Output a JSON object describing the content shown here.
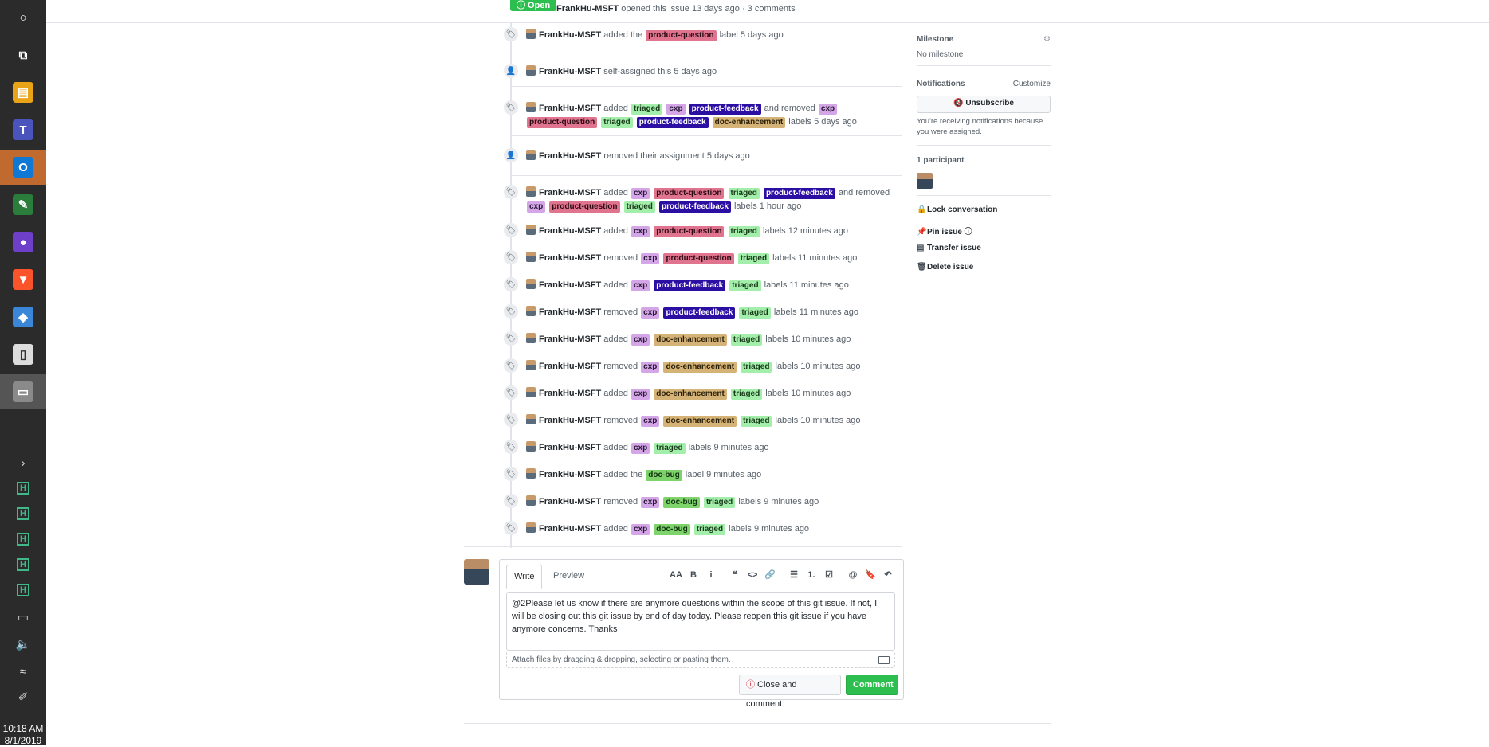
{
  "taskbar": {
    "apps": [
      {
        "name": "cortana",
        "glyph": "○"
      },
      {
        "name": "task-view",
        "glyph": "⧉"
      },
      {
        "name": "file-explorer",
        "glyph": "▤"
      },
      {
        "name": "teams",
        "glyph": "T"
      },
      {
        "name": "outlook",
        "glyph": "O"
      },
      {
        "name": "notepad-plus",
        "glyph": "✎"
      },
      {
        "name": "github-desktop",
        "glyph": "●"
      },
      {
        "name": "brave",
        "glyph": "▼"
      },
      {
        "name": "app-blue",
        "glyph": "◆"
      },
      {
        "name": "document",
        "glyph": "▯"
      },
      {
        "name": "app-window",
        "glyph": "▭"
      }
    ],
    "tray_glyphs": [
      "›",
      "H",
      "H",
      "H",
      "H",
      "H",
      "▭",
      "🔈",
      "≈",
      "✐"
    ],
    "time": "10:18 AM",
    "date": "8/1/2019"
  },
  "header": {
    "state": "ⓘ Open",
    "author": "FrankHu-MSFT",
    "meta": " opened this issue 13 days ago · 3 comments"
  },
  "timeline": [
    {
      "icon": "tag",
      "parts": [
        {
          "t": "text",
          "v": "added the"
        },
        {
          "t": "label",
          "v": "product-question"
        },
        {
          "t": "text",
          "v": "label 5 days ago"
        }
      ]
    },
    {
      "icon": "person",
      "parts": [
        {
          "t": "text",
          "v": "self-assigned this 5 days ago"
        }
      ]
    },
    {
      "icon": "tag",
      "parts": [
        {
          "t": "text",
          "v": "added"
        },
        {
          "t": "label",
          "v": "triaged"
        },
        {
          "t": "label",
          "v": "cxp"
        },
        {
          "t": "label",
          "v": "product-feedback"
        },
        {
          "t": "text",
          "v": "and removed"
        },
        {
          "t": "label",
          "v": "cxp"
        },
        {
          "t": "label",
          "v": "product-question"
        },
        {
          "t": "label",
          "v": "triaged"
        },
        {
          "t": "label",
          "v": "product-feedback"
        },
        {
          "t": "label",
          "v": "doc-enhancement"
        },
        {
          "t": "text",
          "v": "labels 5 days ago"
        }
      ]
    },
    {
      "icon": "person",
      "parts": [
        {
          "t": "text",
          "v": "removed their assignment 5 days ago"
        }
      ]
    },
    {
      "icon": "tag",
      "parts": [
        {
          "t": "text",
          "v": "added"
        },
        {
          "t": "label",
          "v": "cxp"
        },
        {
          "t": "label",
          "v": "product-question"
        },
        {
          "t": "label",
          "v": "triaged"
        },
        {
          "t": "label",
          "v": "product-feedback"
        },
        {
          "t": "text",
          "v": "and removed"
        },
        {
          "t": "label",
          "v": "cxp"
        },
        {
          "t": "label",
          "v": "product-question"
        },
        {
          "t": "label",
          "v": "triaged"
        },
        {
          "t": "label",
          "v": "product-feedback"
        },
        {
          "t": "text",
          "v": "labels 1 hour ago"
        }
      ]
    },
    {
      "icon": "tag",
      "parts": [
        {
          "t": "text",
          "v": "added"
        },
        {
          "t": "label",
          "v": "cxp"
        },
        {
          "t": "label",
          "v": "product-question"
        },
        {
          "t": "label",
          "v": "triaged"
        },
        {
          "t": "text",
          "v": "labels 12 minutes ago"
        }
      ]
    },
    {
      "icon": "tag",
      "parts": [
        {
          "t": "text",
          "v": "removed"
        },
        {
          "t": "label",
          "v": "cxp"
        },
        {
          "t": "label",
          "v": "product-question"
        },
        {
          "t": "label",
          "v": "triaged"
        },
        {
          "t": "text",
          "v": "labels 11 minutes ago"
        }
      ]
    },
    {
      "icon": "tag",
      "parts": [
        {
          "t": "text",
          "v": "added"
        },
        {
          "t": "label",
          "v": "cxp"
        },
        {
          "t": "label",
          "v": "product-feedback"
        },
        {
          "t": "label",
          "v": "triaged"
        },
        {
          "t": "text",
          "v": "labels 11 minutes ago"
        }
      ]
    },
    {
      "icon": "tag",
      "parts": [
        {
          "t": "text",
          "v": "removed"
        },
        {
          "t": "label",
          "v": "cxp"
        },
        {
          "t": "label",
          "v": "product-feedback"
        },
        {
          "t": "label",
          "v": "triaged"
        },
        {
          "t": "text",
          "v": "labels 11 minutes ago"
        }
      ]
    },
    {
      "icon": "tag",
      "parts": [
        {
          "t": "text",
          "v": "added"
        },
        {
          "t": "label",
          "v": "cxp"
        },
        {
          "t": "label",
          "v": "doc-enhancement"
        },
        {
          "t": "label",
          "v": "triaged"
        },
        {
          "t": "text",
          "v": "labels 10 minutes ago"
        }
      ]
    },
    {
      "icon": "tag",
      "parts": [
        {
          "t": "text",
          "v": "removed"
        },
        {
          "t": "label",
          "v": "cxp"
        },
        {
          "t": "label",
          "v": "doc-enhancement"
        },
        {
          "t": "label",
          "v": "triaged"
        },
        {
          "t": "text",
          "v": "labels 10 minutes ago"
        }
      ]
    },
    {
      "icon": "tag",
      "parts": [
        {
          "t": "text",
          "v": "added"
        },
        {
          "t": "label",
          "v": "cxp"
        },
        {
          "t": "label",
          "v": "doc-enhancement"
        },
        {
          "t": "label",
          "v": "triaged"
        },
        {
          "t": "text",
          "v": "labels 10 minutes ago"
        }
      ]
    },
    {
      "icon": "tag",
      "parts": [
        {
          "t": "text",
          "v": "removed"
        },
        {
          "t": "label",
          "v": "cxp"
        },
        {
          "t": "label",
          "v": "doc-enhancement"
        },
        {
          "t": "label",
          "v": "triaged"
        },
        {
          "t": "text",
          "v": "labels 10 minutes ago"
        }
      ]
    },
    {
      "icon": "tag",
      "parts": [
        {
          "t": "text",
          "v": "added"
        },
        {
          "t": "label",
          "v": "cxp"
        },
        {
          "t": "label",
          "v": "triaged"
        },
        {
          "t": "text",
          "v": "labels 9 minutes ago"
        }
      ]
    },
    {
      "icon": "tag",
      "parts": [
        {
          "t": "text",
          "v": "added the"
        },
        {
          "t": "label",
          "v": "doc-bug"
        },
        {
          "t": "text",
          "v": "label 9 minutes ago"
        }
      ]
    },
    {
      "icon": "tag",
      "parts": [
        {
          "t": "text",
          "v": "removed"
        },
        {
          "t": "label",
          "v": "cxp"
        },
        {
          "t": "label",
          "v": "doc-bug"
        },
        {
          "t": "label",
          "v": "triaged"
        },
        {
          "t": "text",
          "v": "labels 9 minutes ago"
        }
      ]
    },
    {
      "icon": "tag",
      "parts": [
        {
          "t": "text",
          "v": "added"
        },
        {
          "t": "label",
          "v": "cxp"
        },
        {
          "t": "label",
          "v": "doc-bug"
        },
        {
          "t": "label",
          "v": "triaged"
        },
        {
          "t": "text",
          "v": "labels 9 minutes ago"
        }
      ]
    }
  ],
  "actor": "FrankHu-MSFT",
  "comment": {
    "tab_write": "Write",
    "tab_preview": "Preview",
    "toolbar": [
      "AA",
      "B",
      "i",
      "❝",
      "<>",
      "🔗",
      "☰",
      "1.",
      "☑",
      "@",
      "🔖",
      "↶"
    ],
    "text": "@2Please let us know if there are anymore questions within the scope of this git issue. If not, I will be closing out this git issue by end of day today. Please reopen this git issue if you have anymore concerns. Thanks",
    "attach_hint": "Attach files by dragging & dropping, selecting or pasting them.",
    "close_button": "Close and comment",
    "comment_button": "Comment"
  },
  "sidebar": {
    "milestone_head": "Milestone",
    "milestone_value": "No milestone",
    "notifications_head": "Notifications",
    "customize": "Customize",
    "unsubscribe": "Unsubscribe",
    "notif_reason": "You're receiving notifications because you were assigned.",
    "participants_head": "1 participant",
    "lock": "Lock conversation",
    "pin": "Pin issue",
    "transfer": "Transfer issue",
    "delete": "Delete issue"
  }
}
